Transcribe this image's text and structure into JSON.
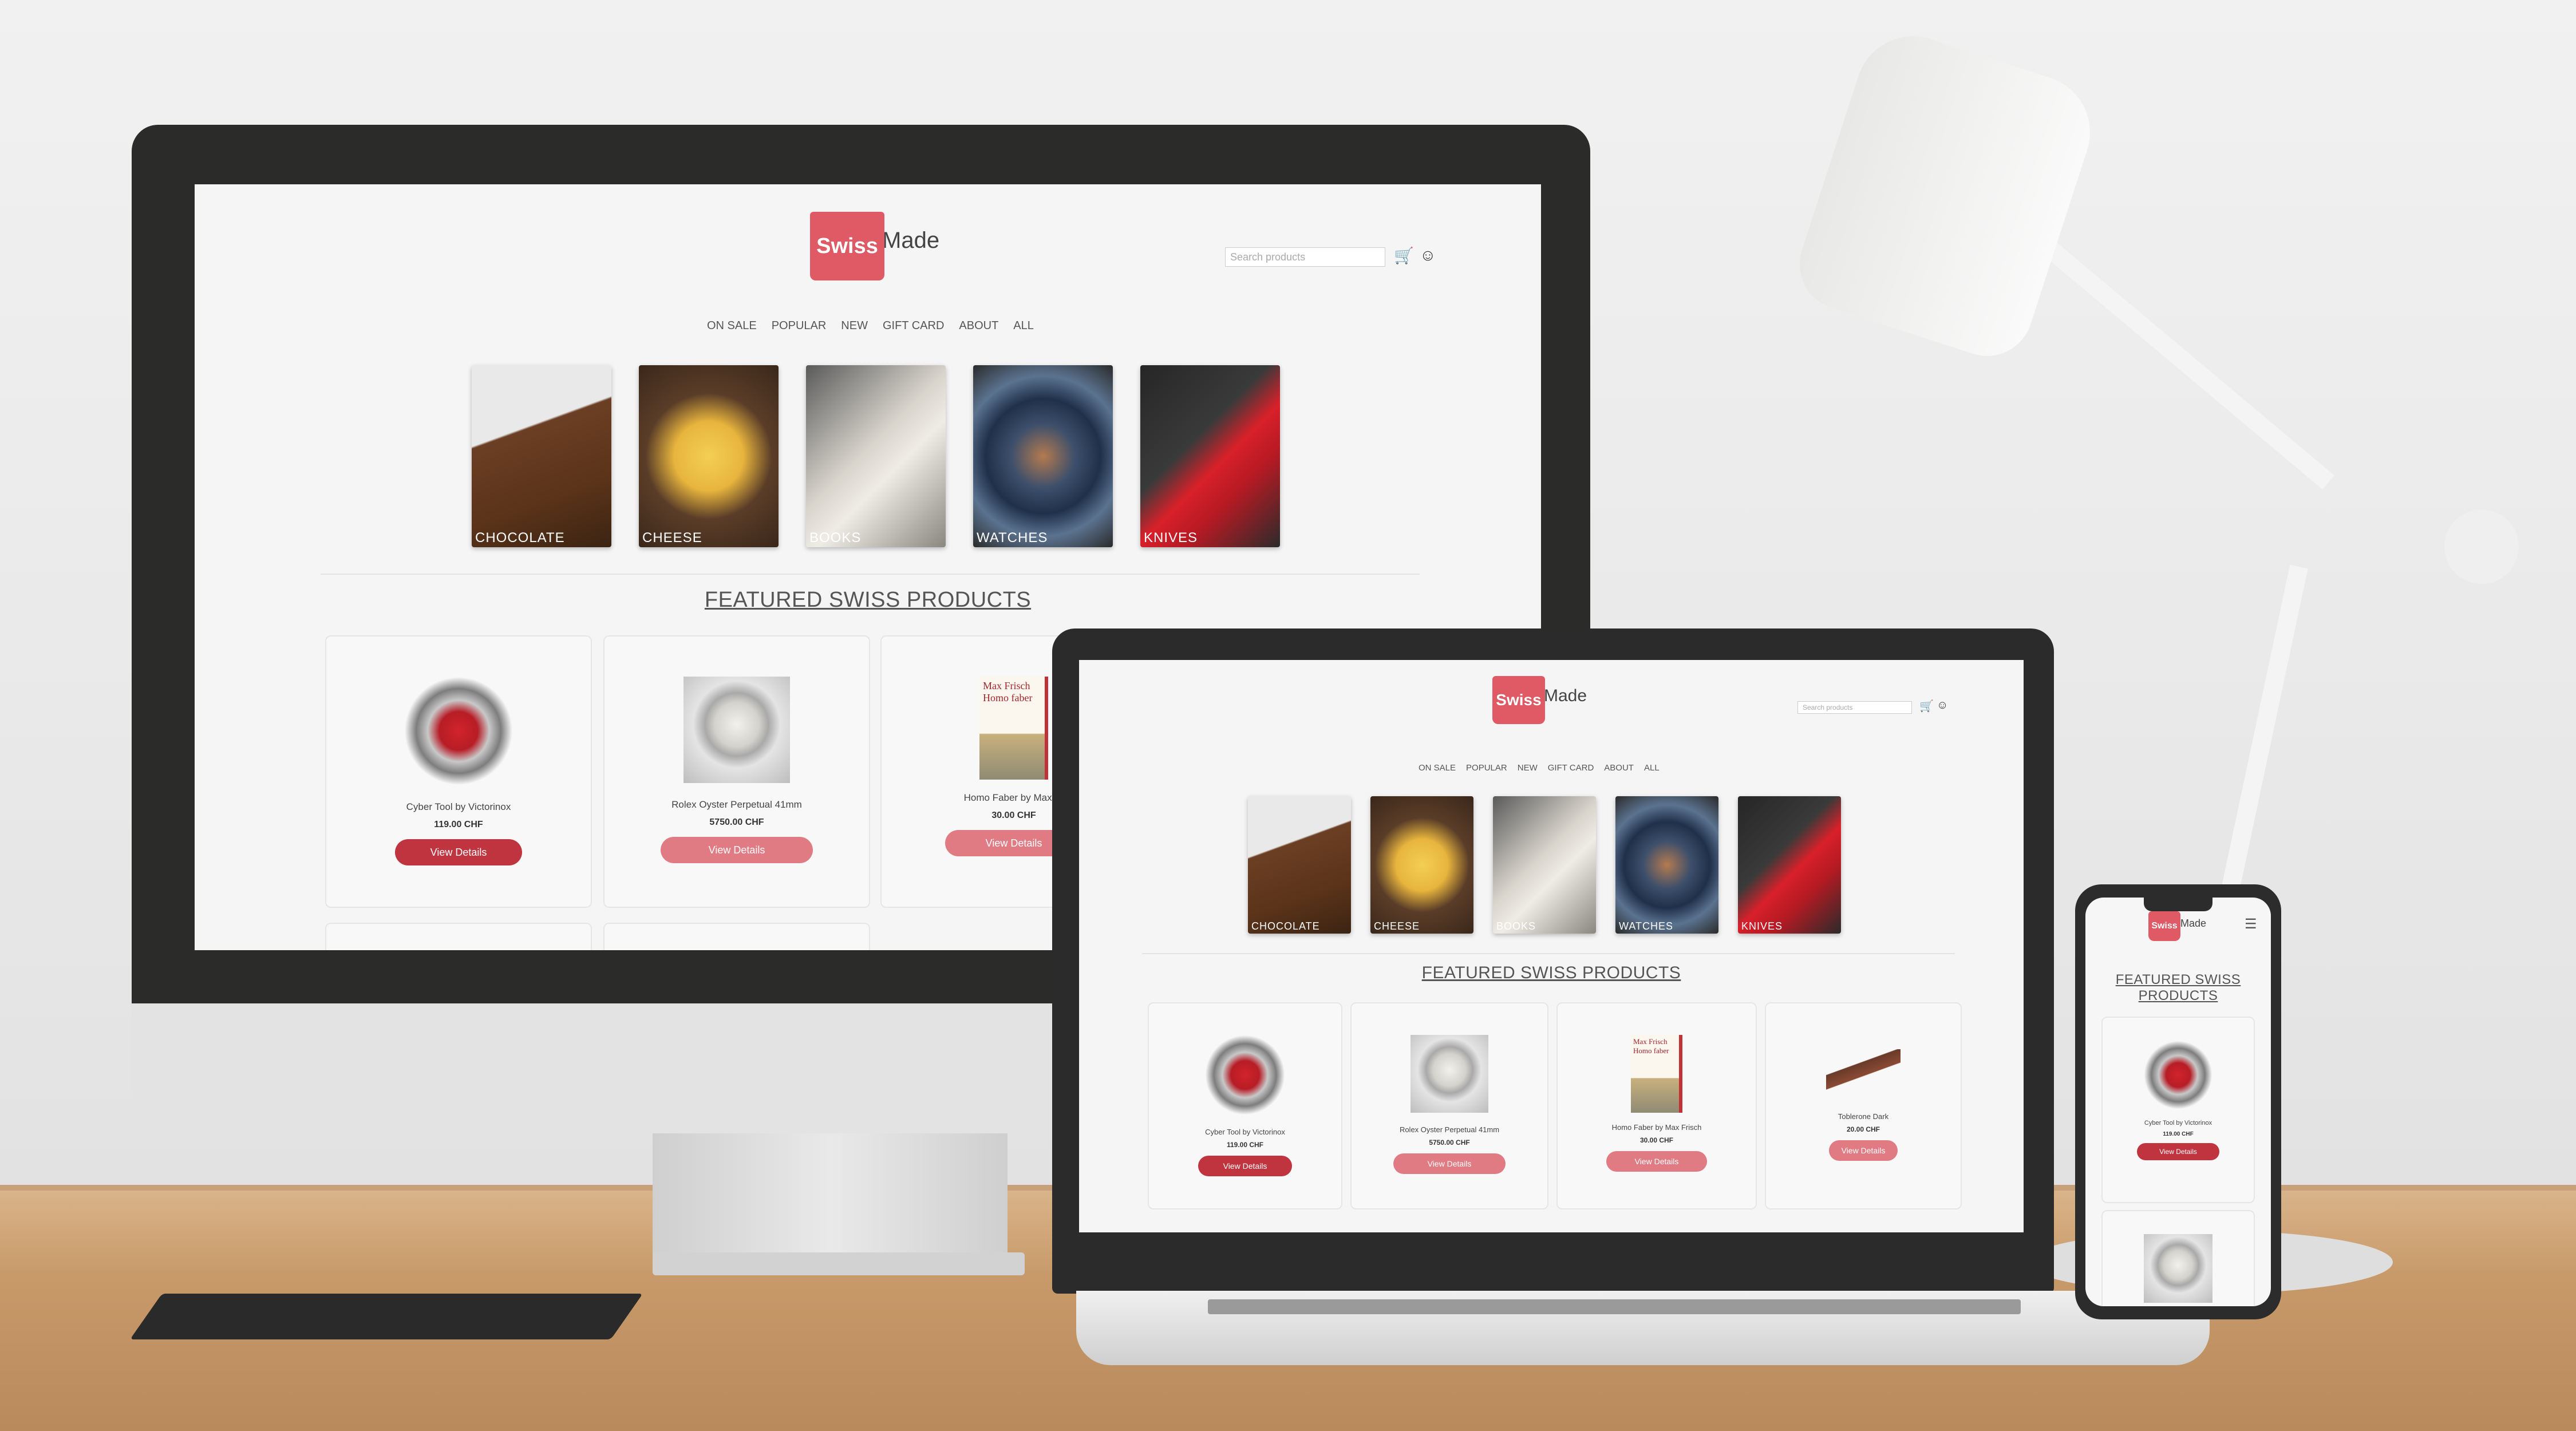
{
  "brand": {
    "swiss": "Swiss",
    "made": "Made",
    "accent": "#e05a66"
  },
  "search": {
    "placeholder": "Search products"
  },
  "nav": [
    "ON SALE",
    "POPULAR",
    "NEW",
    "GIFT CARD",
    "ABOUT",
    "ALL"
  ],
  "categories": [
    "CHOCOLATE",
    "CHEESE",
    "BOOKS",
    "WATCHES",
    "KNIVES"
  ],
  "featured_title": "FEATURED SWISS PRODUCTS",
  "featured_title_mobile_1": "FEATURED SWISS",
  "featured_title_mobile_2": "PRODUCTS",
  "products": [
    {
      "name": "Cyber Tool by Victorinox",
      "price": "119.00 CHF",
      "button": "View Details"
    },
    {
      "name": "Rolex Oyster Perpetual 41mm",
      "price": "5750.00 CHF",
      "button": "View Details"
    },
    {
      "name": "Homo Faber by Max Frisch",
      "price": "30.00 CHF",
      "button": "View Details"
    },
    {
      "name": "Toblerone Dark",
      "price": "20.00 CHF",
      "button": "View Details"
    }
  ],
  "monitor_book_name_partial": "Homo Faber by Max Fr",
  "book_cover": {
    "author": "Max Frisch",
    "title": "Homo faber"
  },
  "icons": {
    "cart": "cart-icon",
    "account": "account-icon",
    "menu": "hamburger-menu-icon"
  }
}
